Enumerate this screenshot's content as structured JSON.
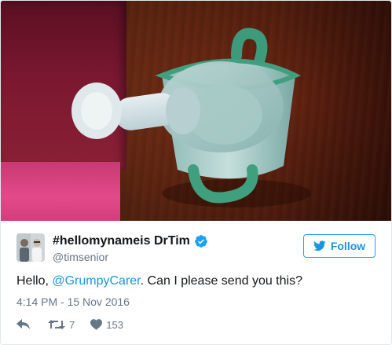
{
  "photo": {
    "description_icon": "sippy-cup-photo"
  },
  "author": {
    "display_name": "#hellomynameis DrTim",
    "handle": "@timsenior",
    "verified": true,
    "avatar_icon": "avatar-photo"
  },
  "follow_button": {
    "label": "Follow",
    "icon": "twitter-bird-icon"
  },
  "tweet": {
    "text_before": "Hello, ",
    "mention": "@GrumpyCarer",
    "text_after": ". Can I please send you this?",
    "timestamp": "4:14 PM - 15 Nov 2016"
  },
  "actions": {
    "reply_icon": "reply-icon",
    "retweet_icon": "retweet-icon",
    "retweet_count": "7",
    "like_icon": "heart-icon",
    "like_count": "153"
  },
  "colors": {
    "link": "#1b95e0",
    "verified": "#1da1f2",
    "muted": "#657786"
  }
}
